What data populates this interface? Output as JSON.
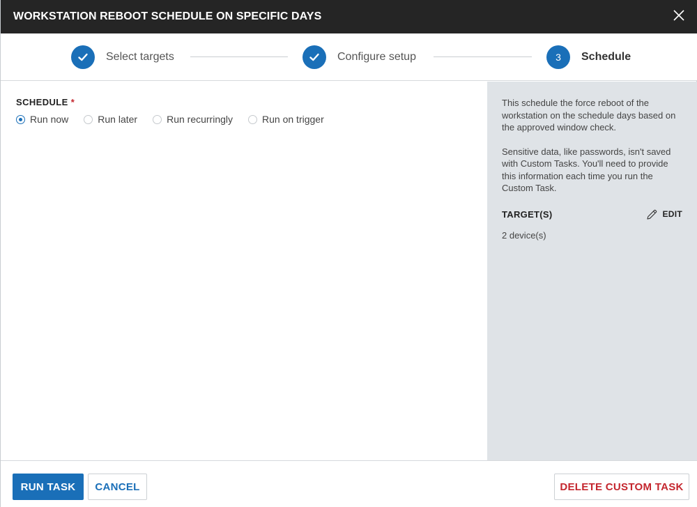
{
  "dialog": {
    "title": "WORKSTATION REBOOT SCHEDULE ON SPECIFIC DAYS",
    "close_icon": "close-icon"
  },
  "stepper": {
    "steps": [
      {
        "label": "Select targets",
        "state": "complete",
        "icon": "check-icon"
      },
      {
        "label": "Configure setup",
        "state": "complete",
        "icon": "check-icon"
      },
      {
        "label": "Schedule",
        "state": "active",
        "number": "3"
      }
    ]
  },
  "schedule": {
    "label": "SCHEDULE",
    "required_marker": "*",
    "options": [
      {
        "label": "Run now",
        "selected": true
      },
      {
        "label": "Run later",
        "selected": false
      },
      {
        "label": "Run recurringly",
        "selected": false
      },
      {
        "label": "Run on trigger",
        "selected": false
      }
    ]
  },
  "sidebar": {
    "description": "This schedule the force reboot of the workstation on the schedule days based on the approved window check.",
    "note": "Sensitive data, like passwords, isn't saved with Custom Tasks. You'll need to provide this information each time you run the Custom Task.",
    "targets_label": "TARGET(S)",
    "edit_label": "EDIT",
    "edit_icon": "pencil-icon",
    "device_count": "2 device(s)"
  },
  "footer": {
    "run_label": "RUN TASK",
    "cancel_label": "CANCEL",
    "delete_label": "DELETE CUSTOM TASK"
  },
  "colors": {
    "accent": "#1a6fb8",
    "titlebar": "#252525",
    "danger": "#c4262e",
    "sidebar_bg": "#dfe3e7"
  }
}
